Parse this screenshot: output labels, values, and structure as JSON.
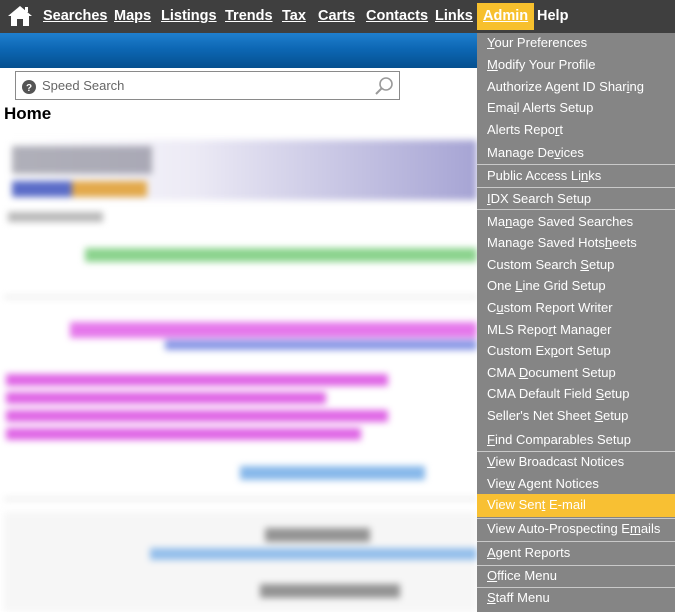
{
  "nav": {
    "items": [
      {
        "id": "searches",
        "label": "Searches",
        "ul": 0
      },
      {
        "id": "maps",
        "label": "Maps",
        "ul": 0
      },
      {
        "id": "listings",
        "label": "Listings",
        "ul": 0
      },
      {
        "id": "trends",
        "label": "Trends",
        "ul": 3
      },
      {
        "id": "tax",
        "label": "Tax",
        "ul": 0
      },
      {
        "id": "carts",
        "label": "Carts",
        "ul": 1
      },
      {
        "id": "contacts",
        "label": "Contacts",
        "ul": 5
      },
      {
        "id": "links",
        "label": "Links",
        "ul": 0
      },
      {
        "id": "admin",
        "label": "Admin",
        "ul": 0
      },
      {
        "id": "help",
        "label": "Help",
        "ul": 0
      }
    ],
    "active": "admin",
    "active_color": "#f7c02d"
  },
  "search": {
    "placeholder": "Speed Search"
  },
  "page": {
    "title": "Home"
  },
  "admin_menu": {
    "items": [
      {
        "label": "Your Preferences",
        "ul": 0
      },
      {
        "label": "Modify Your Profile",
        "ul": 0
      },
      {
        "label": "Authorize Agent ID Sharing",
        "ul": 23
      },
      {
        "label": "Email Alerts Setup",
        "ul": 3
      },
      {
        "label": "Alerts Report",
        "ul": 11
      },
      {
        "label": "Manage Devices",
        "ul": 9
      },
      {
        "label": "Public Access Links",
        "ul": 16
      },
      {
        "label": "IDX Search Setup",
        "ul": 0
      },
      {
        "label": "Manage Saved Searches",
        "ul": 2
      },
      {
        "label": "Manage Saved Hotsheets",
        "ul": 17
      },
      {
        "label": "Custom Search Setup",
        "ul": 14
      },
      {
        "label": "One Line Grid Setup",
        "ul": 4
      },
      {
        "label": "Custom Report Writer",
        "ul": 1
      },
      {
        "label": "MLS Report Manager",
        "ul": 8
      },
      {
        "label": "Custom Export Setup",
        "ul": 9
      },
      {
        "label": "CMA Document Setup",
        "ul": 4
      },
      {
        "label": "CMA Default Field Setup",
        "ul": 18
      },
      {
        "label": "Seller's Net Sheet Setup",
        "ul": 19
      },
      {
        "label": "Find Comparables Setup",
        "ul": 0
      },
      {
        "label": "View Broadcast Notices",
        "ul": 0
      },
      {
        "label": "View Agent Notices",
        "ul": 3
      },
      {
        "label": "View Sent E-mail",
        "ul": 8
      },
      {
        "label": "View Auto-Prospecting Emails",
        "ul": 23
      },
      {
        "label": "Agent Reports",
        "ul": 0
      },
      {
        "label": "Office Menu",
        "ul": 0
      },
      {
        "label": "Staff Menu",
        "ul": 0
      }
    ],
    "highlighted": "View Sent E-mail",
    "highlight_color": "#f8c033"
  }
}
